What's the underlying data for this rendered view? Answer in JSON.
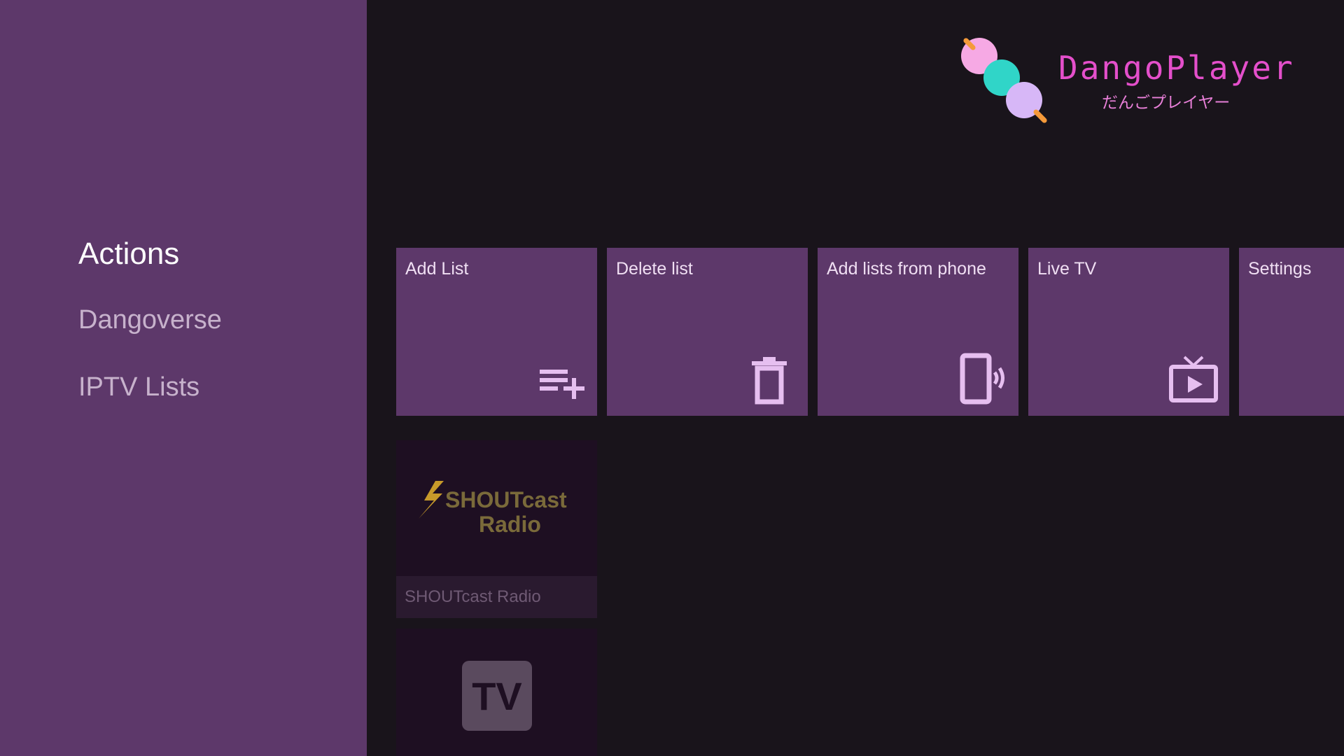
{
  "app": {
    "logo_title": "DangoPlayer",
    "logo_subtitle": "だんごプレイヤー"
  },
  "sidebar": {
    "items": [
      {
        "label": "Actions",
        "active": true
      },
      {
        "label": "Dangoverse",
        "active": false
      },
      {
        "label": "IPTV Lists",
        "active": false
      }
    ]
  },
  "actions": {
    "cards": [
      {
        "label": "Add List",
        "icon": "playlist-add-icon"
      },
      {
        "label": "Delete list",
        "icon": "trash-icon"
      },
      {
        "label": "Add lists from phone",
        "icon": "phone-cast-icon"
      },
      {
        "label": "Live TV",
        "icon": "live-tv-icon"
      },
      {
        "label": "Settings",
        "icon": "settings-icon"
      }
    ]
  },
  "lists": [
    {
      "caption": "SHOUTcast Radio",
      "logo_text_1": "SHOUTcast",
      "logo_text_2": "Radio"
    },
    {
      "caption": "",
      "logo_text_1": "TV"
    }
  ],
  "colors": {
    "background": "#19141b",
    "sidebar": "#5d386a",
    "card": "#5d386a",
    "icon": "#e6bff0",
    "dango_pink": "#f6a9e4",
    "dango_teal": "#30d5c8",
    "dango_lavender": "#d7b7f7",
    "stick": "#f59a3a",
    "logo_text": "#e44fcb"
  }
}
